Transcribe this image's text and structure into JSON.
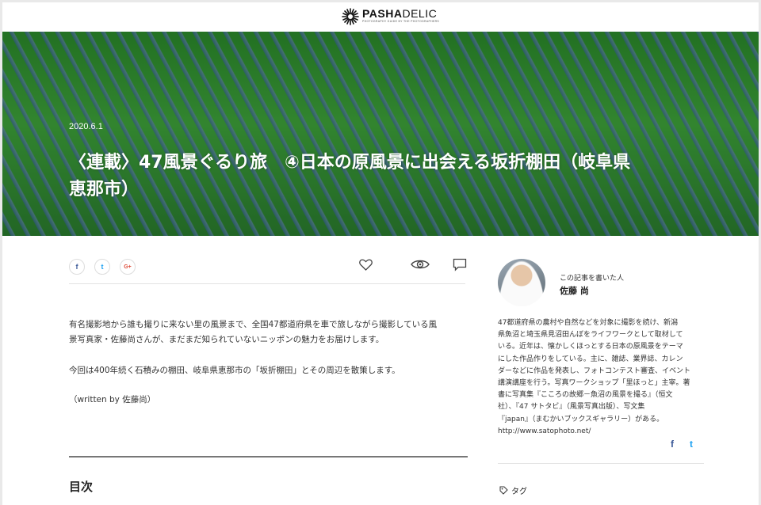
{
  "site": {
    "brand_bold": "PASHA",
    "brand_rest": "DELIC",
    "tagline": "PHOTOGRAPHY GUIDE BY THE PHOTOGRAPHERS"
  },
  "hero": {
    "date": "2020.6.1",
    "title_line1": "〈連載〉47風景ぐるり旅　④日本の原風景に出会える坂折棚田（岐阜県",
    "title_line2": "恵那市）"
  },
  "share": {
    "facebook": "f",
    "twitter": "t",
    "googleplus": "G+"
  },
  "actions": {
    "like": "heart-icon",
    "views": "eye-icon",
    "comment": "comment-icon"
  },
  "article": {
    "para1_line1": "有名撮影地から誰も撮りに来ない里の風景まで、全国47都道府県を車で旅しながら撮影している風",
    "para1_line2": "景写真家・佐藤尚さんが、まだまだ知られていないニッポンの魅力をお届けします。",
    "para2": "今回は400年続く石積みの棚田、岐阜県恵那市の「坂折棚田」とその周辺を散策します。",
    "credit": "（written by 佐藤尚）",
    "toc_title": "目次"
  },
  "author": {
    "label": "この記事を書いた人",
    "name": "佐藤 尚",
    "bio_lines": [
      "47都道府県の農村や自然などを対象に撮影を続け、新潟",
      "県魚沼と埼玉県見沼田んぼをライフワークとして取材して",
      "いる。近年は、懐かしくほっとする日本の原風景をテーマ",
      "にした作品作りをしている。主に、雑誌、業界誌、カレン",
      "ダーなどに作品を発表し、フォトコンテスト審査、イベント",
      "講演講座を行う。写真ワークショップ「里ほっと」主宰。著",
      "書に写真集『こころの故郷－魚沼の風景を撮る』（恒文",
      "社）、『47 サトタビ』（風景写真出版）、写文集",
      "『japan』（まむかいブックスギャラリー）がある。",
      "http://www.satophoto.net/"
    ],
    "social_facebook": "f",
    "social_twitter": "t"
  },
  "sidebar": {
    "tags_label": "タグ"
  },
  "colors": {
    "facebook": "#3b5998",
    "twitter": "#1da1f2",
    "googleplus": "#dd4b39"
  }
}
